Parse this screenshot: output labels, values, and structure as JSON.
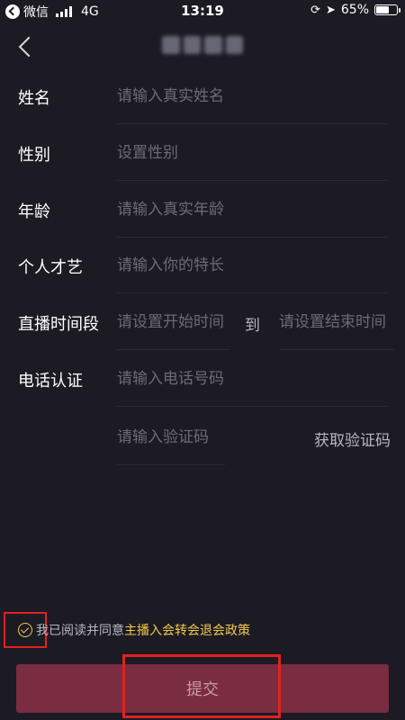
{
  "status_bar": {
    "back_app_label": "微信",
    "network": "4G",
    "time": "13:19",
    "battery_percent_label": "65%",
    "battery_level": 0.65
  },
  "form": {
    "name": {
      "label": "姓名",
      "placeholder": "请输入真实姓名"
    },
    "gender": {
      "label": "性别",
      "placeholder": "设置性别"
    },
    "age": {
      "label": "年龄",
      "placeholder": "请输入真实年龄"
    },
    "talent": {
      "label": "个人才艺",
      "placeholder": "请输入你的特长"
    },
    "live_time": {
      "label": "直播时间段",
      "start_placeholder": "请设置开始时间",
      "separator": "到",
      "end_placeholder": "请设置结束时间"
    },
    "phone": {
      "label": "电话认证",
      "placeholder": "请输入电话号码"
    },
    "code": {
      "placeholder": "请输入验证码",
      "get_code_label": "获取验证码"
    }
  },
  "agreement": {
    "text": "我已阅读并同意",
    "link": "主播入会转会退会政策"
  },
  "submit_label": "提交",
  "colors": {
    "background": "#1c1b24",
    "accent": "#f2c84b",
    "submit": "#7a2c40",
    "highlight": "#e0221e"
  }
}
